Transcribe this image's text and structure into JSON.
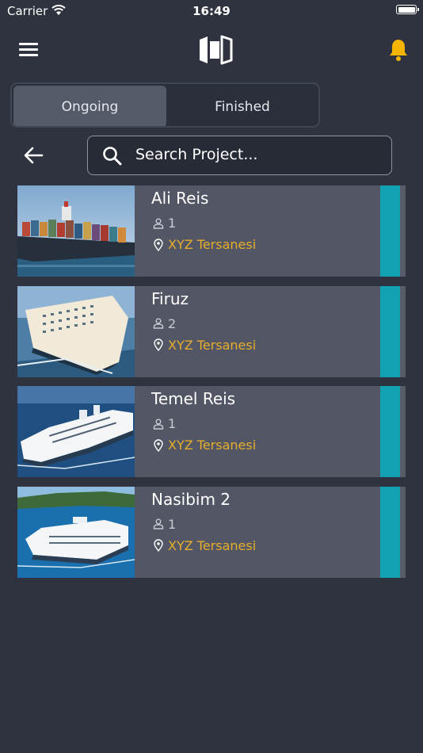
{
  "status_bar": {
    "carrier": "Carrier",
    "time": "16:49"
  },
  "header": {
    "menu_icon": "hamburger-icon",
    "logo_icon": "app-logo",
    "notification_icon": "bell-icon"
  },
  "tabs": [
    {
      "label": "Ongoing",
      "selected": true
    },
    {
      "label": "Finished",
      "selected": false
    }
  ],
  "search": {
    "placeholder": "Search Project..."
  },
  "colors": {
    "background": "#2f3340",
    "card": "#535765",
    "accent": "#13a1b4",
    "location": "#e6ad2c",
    "bell": "#f4b400"
  },
  "projects": [
    {
      "name": "Ali Reis",
      "crew": "1",
      "location": "XYZ Tersanesi",
      "image": "container-ship"
    },
    {
      "name": "Firuz",
      "crew": "2",
      "location": "XYZ Tersanesi",
      "image": "cruise-ship-bow"
    },
    {
      "name": "Temel Reis",
      "crew": "1",
      "location": "XYZ Tersanesi",
      "image": "cruise-ship-sea"
    },
    {
      "name": "Nasibim 2",
      "crew": "1",
      "location": "XYZ Tersanesi",
      "image": "cruise-ship-coast"
    }
  ]
}
